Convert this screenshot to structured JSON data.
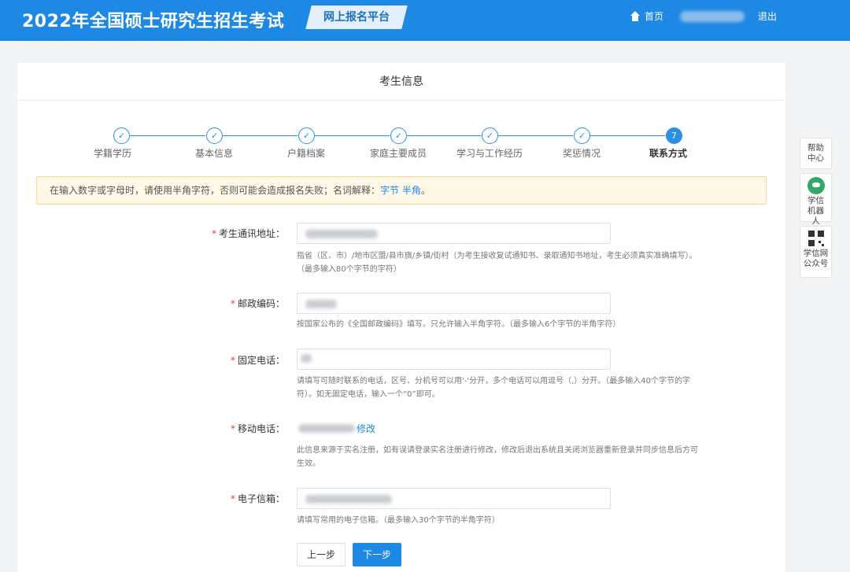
{
  "header": {
    "title": "2022年全国硕士研究生招生考试",
    "platform": "网上报名平台",
    "home_label": "首页",
    "logout_label": "退出"
  },
  "card": {
    "title": "考生信息"
  },
  "steps": [
    {
      "label": "学籍学历",
      "state": "done"
    },
    {
      "label": "基本信息",
      "state": "done"
    },
    {
      "label": "户籍档案",
      "state": "done"
    },
    {
      "label": "家庭主要成员",
      "state": "done"
    },
    {
      "label": "学习与工作经历",
      "state": "done"
    },
    {
      "label": "奖惩情况",
      "state": "done"
    },
    {
      "label": "联系方式",
      "state": "current",
      "number": "7"
    }
  ],
  "step_done_mark": "✓",
  "notice": {
    "text": "在输入数字或字母时，请使用半角字符，否则可能会造成报名失败；名词解释：",
    "link1": "字节",
    "link2": "半角",
    "end": "。"
  },
  "form": {
    "required_mark": "*",
    "address": {
      "label": "考生通讯地址：",
      "hint": "指省（区、市）/地市区盟/县市旗/乡镇/街村（为考生接收复试通知书、录取通知书地址，考生必须真实准确填写）。（最多输入80个字节的字符）"
    },
    "postcode": {
      "label": "邮政编码：",
      "hint": "按国家公布的《全国邮政编码》填写。只允许输入半角字符。（最多输入6个字节的半角字符）"
    },
    "phone": {
      "label": "固定电话：",
      "hint": "请填写可随时联系的电话，区号、分机号可以用'-'分开，多个电话可以用逗号（,）分开。（最多输入40个字节的字符）。如无固定电话，输入一个“0”即可。"
    },
    "mobile": {
      "label": "移动电话：",
      "modify": "修改",
      "hint": "此信息来源于实名注册，如有误请登录实名注册进行修改，修改后退出系统且关闭浏览器重新登录并同步信息后方可生效。"
    },
    "email": {
      "label": "电子信箱：",
      "hint": "请填写常用的电子信箱。（最多输入30个字节的半角字符）"
    },
    "prev_label": "上一步",
    "next_label": "下一步"
  },
  "sidebar": {
    "help": "帮助中心",
    "robot": "学信机器人",
    "wechat": "学信网公众号"
  }
}
